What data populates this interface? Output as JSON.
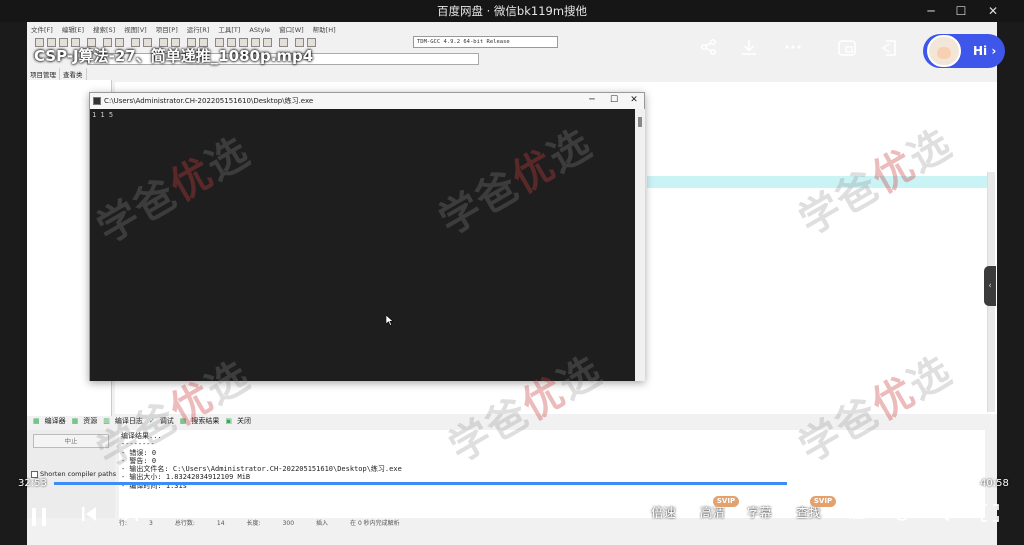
{
  "window": {
    "title": "百度网盘 · 微信bk119m搜他",
    "minimize": "─",
    "maximize": "☐",
    "close": "✕"
  },
  "video": {
    "title": "CSP-J算法-27、简单递推_1080p.mp4",
    "time_current": "32:53",
    "time_total": "40:58",
    "progress": 0.8,
    "share_icon": "share-icon",
    "download_icon": "download-icon",
    "more_icon": "more-icon",
    "hi_label": "Hi ›"
  },
  "controls": {
    "speed": "倍速",
    "quality": "高清",
    "subtitles": "字幕",
    "search": "查找",
    "svip_badge": "SVIP"
  },
  "ide": {
    "menu": [
      "文件[F]",
      "编辑[E]",
      "搜索[S]",
      "视图[V]",
      "项目[P]",
      "运行[R]",
      "工具[T]",
      "AStyle",
      "窗口[W]",
      "帮助[H]"
    ],
    "compiler": "TDM-GCC 4.9.2 64-bit Release",
    "left_tabs": [
      "项目管理",
      "查看类"
    ],
    "bottom_tabs": [
      "编译器",
      "资源",
      "编译日志",
      "调试",
      "搜索结果",
      "关闭"
    ],
    "abort_label": "中止",
    "shorten_label": "Shorten compiler paths",
    "log_lines": [
      "编译结果...",
      "--------",
      "- 错误: 0",
      "- 警告: 0",
      "- 输出文件名: C:\\Users\\Administrator.CH-202205151610\\Desktop\\练习.exe",
      "- 输出大小: 1.83242034912109 MiB",
      "- 编译时间: 1.31s"
    ],
    "status": [
      "行:",
      "3",
      "总行数:",
      "14",
      "长度:",
      "300",
      "插入",
      "在 0 秒内完成解析"
    ]
  },
  "console": {
    "title": "C:\\Users\\Administrator.CH-202205151610\\Desktop\\练习.exe",
    "output": "1 1 5"
  },
  "watermark": {
    "text1": "学爸",
    "text2": "优",
    "text3": "选"
  }
}
